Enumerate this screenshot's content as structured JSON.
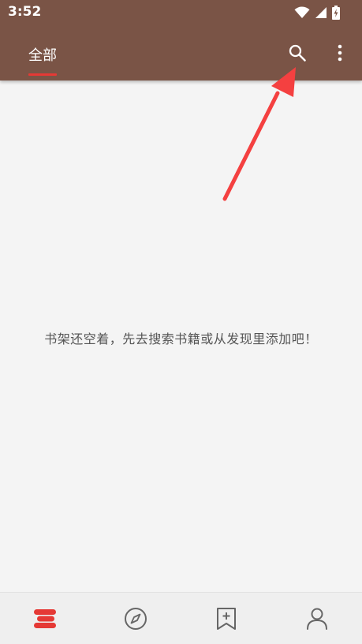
{
  "status_bar": {
    "time": "3:52",
    "icons": [
      "wifi-icon",
      "signal-icon",
      "battery-charging-icon"
    ]
  },
  "app_bar": {
    "tabs": [
      {
        "label": "全部",
        "selected": true
      }
    ],
    "actions": [
      "search-icon",
      "more-vert-icon"
    ]
  },
  "main": {
    "empty_message": "书架还空着，先去搜索书籍或从发现里添加吧！"
  },
  "bottom_nav": {
    "items": [
      {
        "icon": "bookshelf-icon",
        "active": true
      },
      {
        "icon": "compass-icon",
        "active": false
      },
      {
        "icon": "bookmark-add-icon",
        "active": false
      },
      {
        "icon": "person-icon",
        "active": false
      }
    ]
  },
  "colors": {
    "app_bar": "#7a5446",
    "accent": "#e53935",
    "annotation_arrow": "#f44040"
  }
}
